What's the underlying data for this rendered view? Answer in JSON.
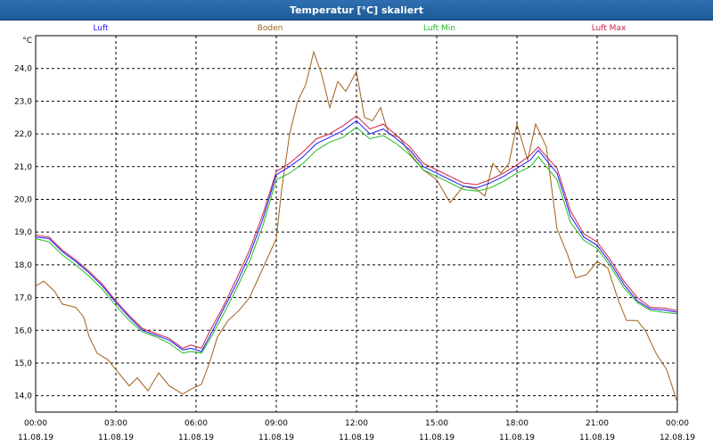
{
  "window": {
    "title": "Temperatur [°C] skaliert"
  },
  "colors": {
    "background": "#ffffff",
    "grid": "#000000",
    "luft": "#1a1aff",
    "boden": "#a0601a",
    "luft_min": "#22bb22",
    "luft_max": "#cc2244"
  },
  "chart_data": {
    "type": "line",
    "title": "Temperatur [°C] skaliert",
    "ylabel": "°C",
    "ylim": [
      13.5,
      25.0
    ],
    "yticks": [
      14.0,
      15.0,
      16.0,
      17.0,
      18.0,
      19.0,
      20.0,
      21.0,
      22.0,
      23.0,
      24.0
    ],
    "ytick_labels": [
      "14,0",
      "15,0",
      "16,0",
      "17,0",
      "18,0",
      "19,0",
      "20,0",
      "21,0",
      "22,0",
      "23,0",
      "24,0"
    ],
    "xlim": [
      0,
      24
    ],
    "x_ticks": [
      {
        "time": "00:00",
        "date": "11.08.19"
      },
      {
        "time": "03:00",
        "date": "11.08.19"
      },
      {
        "time": "06:00",
        "date": "11.08.19"
      },
      {
        "time": "09:00",
        "date": "11.08.19"
      },
      {
        "time": "12:00",
        "date": "11.08.19"
      },
      {
        "time": "15:00",
        "date": "11.08.19"
      },
      {
        "time": "18:00",
        "date": "11.08.19"
      },
      {
        "time": "21:00",
        "date": "11.08.19"
      },
      {
        "time": "00:00",
        "date": "12.08.19"
      }
    ],
    "grid": true,
    "legend_position": "top",
    "series": [
      {
        "name": "Luft",
        "color": "#1a1aff",
        "points": [
          [
            0.0,
            18.85
          ],
          [
            0.5,
            18.8
          ],
          [
            1.0,
            18.4
          ],
          [
            1.5,
            18.1
          ],
          [
            2.0,
            17.75
          ],
          [
            2.5,
            17.35
          ],
          [
            3.0,
            16.85
          ],
          [
            3.5,
            16.4
          ],
          [
            4.0,
            16.0
          ],
          [
            4.5,
            15.85
          ],
          [
            5.0,
            15.7
          ],
          [
            5.5,
            15.4
          ],
          [
            5.8,
            15.45
          ],
          [
            6.2,
            15.35
          ],
          [
            6.5,
            15.8
          ],
          [
            7.0,
            16.6
          ],
          [
            7.5,
            17.4
          ],
          [
            8.0,
            18.3
          ],
          [
            8.5,
            19.4
          ],
          [
            9.0,
            20.75
          ],
          [
            9.5,
            21.0
          ],
          [
            10.0,
            21.3
          ],
          [
            10.5,
            21.7
          ],
          [
            11.0,
            21.9
          ],
          [
            11.5,
            22.1
          ],
          [
            12.0,
            22.4
          ],
          [
            12.5,
            22.0
          ],
          [
            13.0,
            22.15
          ],
          [
            13.5,
            21.85
          ],
          [
            14.0,
            21.5
          ],
          [
            14.5,
            21.0
          ],
          [
            15.0,
            20.8
          ],
          [
            15.5,
            20.6
          ],
          [
            16.0,
            20.4
          ],
          [
            16.5,
            20.35
          ],
          [
            17.0,
            20.5
          ],
          [
            17.5,
            20.7
          ],
          [
            18.0,
            20.95
          ],
          [
            18.5,
            21.2
          ],
          [
            18.8,
            21.5
          ],
          [
            19.0,
            21.3
          ],
          [
            19.5,
            20.8
          ],
          [
            20.0,
            19.5
          ],
          [
            20.5,
            18.85
          ],
          [
            21.0,
            18.6
          ],
          [
            21.5,
            18.05
          ],
          [
            22.0,
            17.4
          ],
          [
            22.5,
            16.9
          ],
          [
            23.0,
            16.65
          ],
          [
            23.5,
            16.62
          ],
          [
            24.0,
            16.55
          ]
        ]
      },
      {
        "name": "Boden",
        "color": "#a0601a",
        "points": [
          [
            0.0,
            17.35
          ],
          [
            0.3,
            17.5
          ],
          [
            0.7,
            17.2
          ],
          [
            1.0,
            16.8
          ],
          [
            1.5,
            16.7
          ],
          [
            1.8,
            16.4
          ],
          [
            2.0,
            15.8
          ],
          [
            2.3,
            15.3
          ],
          [
            2.7,
            15.1
          ],
          [
            3.0,
            14.8
          ],
          [
            3.5,
            14.3
          ],
          [
            3.8,
            14.55
          ],
          [
            4.2,
            14.15
          ],
          [
            4.6,
            14.7
          ],
          [
            5.0,
            14.3
          ],
          [
            5.5,
            14.05
          ],
          [
            5.8,
            14.2
          ],
          [
            6.2,
            14.35
          ],
          [
            6.5,
            15.0
          ],
          [
            6.8,
            15.8
          ],
          [
            7.2,
            16.3
          ],
          [
            7.6,
            16.6
          ],
          [
            8.0,
            17.0
          ],
          [
            8.5,
            17.9
          ],
          [
            9.0,
            18.8
          ],
          [
            9.2,
            20.3
          ],
          [
            9.5,
            22.0
          ],
          [
            9.8,
            23.0
          ],
          [
            10.1,
            23.5
          ],
          [
            10.4,
            24.5
          ],
          [
            10.7,
            23.8
          ],
          [
            11.0,
            22.8
          ],
          [
            11.3,
            23.6
          ],
          [
            11.6,
            23.3
          ],
          [
            12.0,
            23.9
          ],
          [
            12.3,
            22.5
          ],
          [
            12.6,
            22.4
          ],
          [
            12.9,
            22.8
          ],
          [
            13.2,
            22.0
          ],
          [
            13.6,
            21.9
          ],
          [
            14.0,
            21.4
          ],
          [
            14.5,
            20.9
          ],
          [
            15.0,
            20.6
          ],
          [
            15.5,
            19.9
          ],
          [
            16.0,
            20.4
          ],
          [
            16.5,
            20.3
          ],
          [
            16.8,
            20.1
          ],
          [
            17.1,
            21.1
          ],
          [
            17.4,
            20.8
          ],
          [
            17.7,
            21.1
          ],
          [
            18.0,
            22.3
          ],
          [
            18.4,
            21.2
          ],
          [
            18.7,
            22.3
          ],
          [
            19.1,
            21.6
          ],
          [
            19.5,
            19.1
          ],
          [
            19.9,
            18.3
          ],
          [
            20.2,
            17.6
          ],
          [
            20.6,
            17.7
          ],
          [
            21.0,
            18.1
          ],
          [
            21.4,
            17.9
          ],
          [
            21.8,
            16.9
          ],
          [
            22.1,
            16.3
          ],
          [
            22.5,
            16.3
          ],
          [
            22.8,
            16.0
          ],
          [
            23.2,
            15.3
          ],
          [
            23.6,
            14.8
          ],
          [
            24.0,
            13.8
          ]
        ]
      },
      {
        "name": "Luft Min",
        "color": "#22bb22",
        "points": [
          [
            0.0,
            18.8
          ],
          [
            0.5,
            18.7
          ],
          [
            1.0,
            18.3
          ],
          [
            1.5,
            18.0
          ],
          [
            2.0,
            17.65
          ],
          [
            2.5,
            17.25
          ],
          [
            3.0,
            16.75
          ],
          [
            3.5,
            16.3
          ],
          [
            4.0,
            15.95
          ],
          [
            4.5,
            15.8
          ],
          [
            5.0,
            15.6
          ],
          [
            5.5,
            15.3
          ],
          [
            5.8,
            15.35
          ],
          [
            6.2,
            15.3
          ],
          [
            6.5,
            15.7
          ],
          [
            7.0,
            16.45
          ],
          [
            7.5,
            17.25
          ],
          [
            8.0,
            18.1
          ],
          [
            8.5,
            19.2
          ],
          [
            9.0,
            20.6
          ],
          [
            9.5,
            20.8
          ],
          [
            10.0,
            21.1
          ],
          [
            10.5,
            21.5
          ],
          [
            11.0,
            21.75
          ],
          [
            11.5,
            21.9
          ],
          [
            12.0,
            22.2
          ],
          [
            12.5,
            21.85
          ],
          [
            13.0,
            21.95
          ],
          [
            13.5,
            21.7
          ],
          [
            14.0,
            21.35
          ],
          [
            14.5,
            20.9
          ],
          [
            15.0,
            20.7
          ],
          [
            15.5,
            20.5
          ],
          [
            16.0,
            20.3
          ],
          [
            16.5,
            20.25
          ],
          [
            17.0,
            20.35
          ],
          [
            17.5,
            20.55
          ],
          [
            18.0,
            20.8
          ],
          [
            18.5,
            21.0
          ],
          [
            18.8,
            21.3
          ],
          [
            19.0,
            21.1
          ],
          [
            19.5,
            20.6
          ],
          [
            20.0,
            19.3
          ],
          [
            20.5,
            18.75
          ],
          [
            21.0,
            18.5
          ],
          [
            21.5,
            17.95
          ],
          [
            22.0,
            17.3
          ],
          [
            22.5,
            16.85
          ],
          [
            23.0,
            16.6
          ],
          [
            23.5,
            16.55
          ],
          [
            24.0,
            16.5
          ]
        ]
      },
      {
        "name": "Luft Max",
        "color": "#cc2244",
        "points": [
          [
            0.0,
            18.9
          ],
          [
            0.5,
            18.85
          ],
          [
            1.0,
            18.45
          ],
          [
            1.5,
            18.15
          ],
          [
            2.0,
            17.8
          ],
          [
            2.5,
            17.4
          ],
          [
            3.0,
            16.9
          ],
          [
            3.5,
            16.45
          ],
          [
            4.0,
            16.05
          ],
          [
            4.5,
            15.9
          ],
          [
            5.0,
            15.75
          ],
          [
            5.5,
            15.45
          ],
          [
            5.8,
            15.55
          ],
          [
            6.2,
            15.45
          ],
          [
            6.5,
            15.95
          ],
          [
            7.0,
            16.7
          ],
          [
            7.5,
            17.55
          ],
          [
            8.0,
            18.45
          ],
          [
            8.5,
            19.55
          ],
          [
            9.0,
            20.85
          ],
          [
            9.5,
            21.1
          ],
          [
            10.0,
            21.45
          ],
          [
            10.5,
            21.85
          ],
          [
            11.0,
            22.0
          ],
          [
            11.5,
            22.25
          ],
          [
            12.0,
            22.55
          ],
          [
            12.5,
            22.15
          ],
          [
            13.0,
            22.3
          ],
          [
            13.5,
            21.95
          ],
          [
            14.0,
            21.6
          ],
          [
            14.5,
            21.1
          ],
          [
            15.0,
            20.9
          ],
          [
            15.5,
            20.7
          ],
          [
            16.0,
            20.5
          ],
          [
            16.5,
            20.45
          ],
          [
            17.0,
            20.6
          ],
          [
            17.5,
            20.8
          ],
          [
            18.0,
            21.05
          ],
          [
            18.5,
            21.35
          ],
          [
            18.8,
            21.6
          ],
          [
            19.0,
            21.4
          ],
          [
            19.5,
            20.95
          ],
          [
            20.0,
            19.65
          ],
          [
            20.5,
            18.95
          ],
          [
            21.0,
            18.7
          ],
          [
            21.5,
            18.15
          ],
          [
            22.0,
            17.5
          ],
          [
            22.5,
            17.0
          ],
          [
            23.0,
            16.7
          ],
          [
            23.5,
            16.68
          ],
          [
            24.0,
            16.6
          ]
        ]
      }
    ]
  }
}
